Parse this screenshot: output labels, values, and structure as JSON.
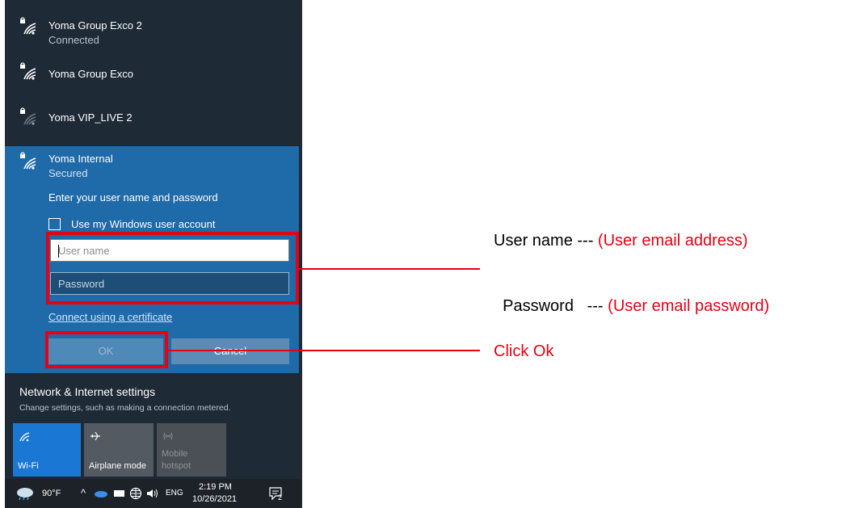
{
  "networks": [
    {
      "name": "Yoma Group Exco 2",
      "status": "Connected"
    },
    {
      "name": "Yoma Group Exco",
      "status": ""
    },
    {
      "name": "Yoma VIP_LIVE 2",
      "status": ""
    }
  ],
  "expanded": {
    "name": "Yoma Internal",
    "status": "Secured",
    "prompt": "Enter your user name and password",
    "checkbox_label": "Use my Windows user account",
    "username_placeholder": "User name",
    "password_placeholder": "Password",
    "cert_link": "Connect using a certificate",
    "ok_label": "OK",
    "cancel_label": "Cancel"
  },
  "settings": {
    "title": "Network & Internet settings",
    "subtitle": "Change settings, such as making a connection metered."
  },
  "tiles": [
    {
      "label": "Wi-Fi",
      "icon": "wifi-icon"
    },
    {
      "label": "Airplane mode",
      "icon": "airplane-icon"
    },
    {
      "label_line1": "Mobile",
      "label_line2": "hotspot",
      "icon": "hotspot-icon"
    }
  ],
  "taskbar": {
    "temperature": "90°F",
    "language": "ENG",
    "time": "2:19 PM",
    "date": "10/26/2021",
    "notification_count": "2"
  },
  "annotations": {
    "username_label": "User name --- ",
    "username_hint": "(User email address)",
    "password_label": "Password   --- ",
    "password_hint": "(User email password)",
    "click_ok": "Click Ok"
  },
  "colors": {
    "panel_bg": "#1e2a36",
    "expanded_bg": "#1f6aa8",
    "accent_red": "#e60012",
    "wifi_tile": "#1a78d4"
  }
}
